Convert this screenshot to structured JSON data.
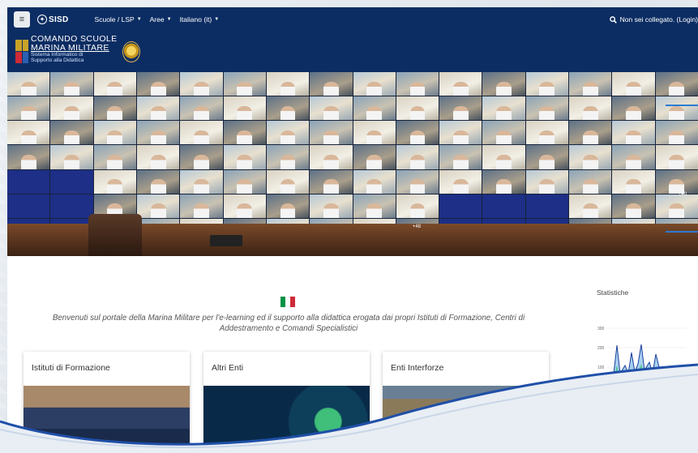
{
  "navbar": {
    "menu_toggle_icon": "menu-icon",
    "logo_text": "SISD",
    "menu": [
      {
        "label": "Scuole / LSP"
      },
      {
        "label": "Aree"
      },
      {
        "label": "Italiano (it)"
      }
    ],
    "login_text": "Non sei collegato. (Login)"
  },
  "brand": {
    "line1": "COMANDO SCUOLE",
    "line2": "MARINA MILITARE",
    "line3": "Sistema Informatico di",
    "line4": "Supporto alla Didattica"
  },
  "hero": {
    "badge1": "+48",
    "badge2": "+40"
  },
  "main": {
    "welcome": "Benvenuti sul portale della Marina Militare per l'e-learning ed il supporto alla didattica erogata dai propri Istituti di Formazione, Centri di Addestramento e Comandi Specialistici",
    "cards": [
      {
        "title": "Istituti di Formazione"
      },
      {
        "title": "Altri Enti"
      },
      {
        "title": "Enti Interforze"
      }
    ]
  },
  "statistics": {
    "label": "Statistiche",
    "ticks": [
      "300",
      "200",
      "100"
    ]
  },
  "colors": {
    "navbar_bg": "#0c2d63",
    "accent_blue": "#2b7bd4",
    "italy_green": "#009246",
    "italy_white": "#ffffff",
    "italy_red": "#ce2b37"
  }
}
